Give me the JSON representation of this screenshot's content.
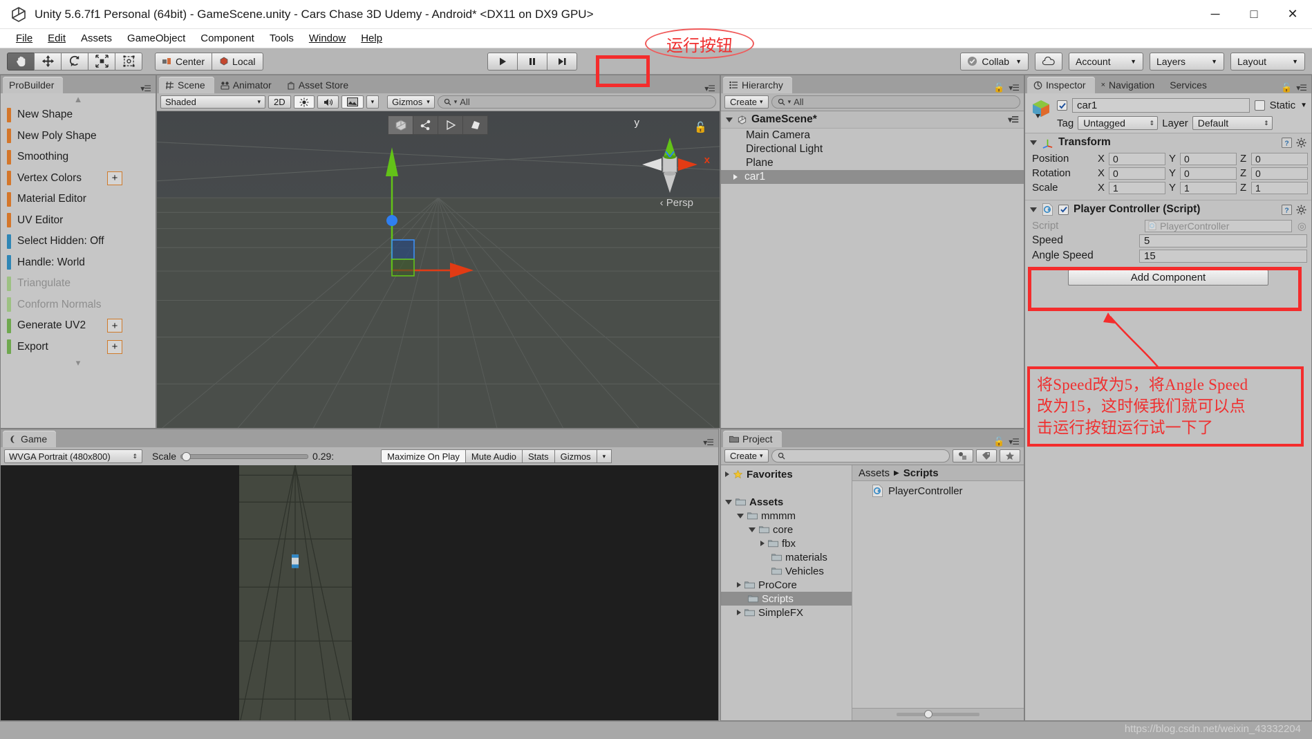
{
  "window": {
    "title": "Unity 5.6.7f1 Personal (64bit) - GameScene.unity - Cars Chase 3D Udemy - Android* <DX11 on DX9 GPU>",
    "minimize": "─",
    "maximize": "□",
    "close": "✕"
  },
  "menu": [
    "File",
    "Edit",
    "Assets",
    "GameObject",
    "Component",
    "Tools",
    "Window",
    "Help"
  ],
  "toolbar": {
    "transform_tools": [
      {
        "name": "hand-tool",
        "active": true
      },
      {
        "name": "move-tool",
        "active": false
      },
      {
        "name": "rotate-tool",
        "active": false
      },
      {
        "name": "scale-tool",
        "active": false
      },
      {
        "name": "rect-tool",
        "active": false
      }
    ],
    "pivot": "Center",
    "handle": "Local",
    "play": "▶",
    "pause": "❙❙",
    "step": "▶❙",
    "collab": "Collab",
    "cloud_icon": "cloud-icon",
    "account": "Account",
    "layers": "Layers",
    "layout": "Layout"
  },
  "probuilder": {
    "tab": "ProBuilder",
    "items": [
      {
        "label": "New Shape",
        "color": "#d4762a",
        "disabled": false,
        "plus": false
      },
      {
        "label": "New Poly Shape",
        "color": "#d4762a",
        "disabled": false,
        "plus": false
      },
      {
        "label": "Smoothing",
        "color": "#d4762a",
        "disabled": false,
        "plus": false
      },
      {
        "label": "Vertex Colors",
        "color": "#d4762a",
        "disabled": false,
        "plus": true
      },
      {
        "label": "Material Editor",
        "color": "#d4762a",
        "disabled": false,
        "plus": false
      },
      {
        "label": "UV Editor",
        "color": "#d4762a",
        "disabled": false,
        "plus": false
      },
      {
        "label": "Select Hidden: Off",
        "color": "#2f86b5",
        "disabled": false,
        "plus": false
      },
      {
        "label": "Handle: World",
        "color": "#2f86b5",
        "disabled": false,
        "plus": false
      },
      {
        "label": "Triangulate",
        "color": "#9dc183",
        "disabled": true,
        "plus": false
      },
      {
        "label": "Conform Normals",
        "color": "#9dc183",
        "disabled": true,
        "plus": false
      },
      {
        "label": "Generate UV2",
        "color": "#6fa84f",
        "disabled": false,
        "plus": true
      },
      {
        "label": "Export",
        "color": "#6fa84f",
        "disabled": false,
        "plus": true
      }
    ]
  },
  "scene": {
    "tabs": [
      {
        "label": "Scene",
        "icon": "grid-icon",
        "active": true
      },
      {
        "label": "Animator",
        "icon": "animator-icon",
        "active": false
      },
      {
        "label": "Asset Store",
        "icon": "store-icon",
        "active": false
      }
    ],
    "draw_mode": "Shaded",
    "two_d": "2D",
    "gizmos": "Gizmos",
    "search_placeholder": "All",
    "axis_x": "x",
    "axis_y": "y",
    "persp": "‹ Persp",
    "overlay_tools": [
      "shape-icon",
      "poly-icon",
      "face-icon",
      "material-icon"
    ]
  },
  "game": {
    "tab": "Game",
    "aspect": "WVGA Portrait (480x800)",
    "scale_label": "Scale",
    "scale_value": "0.29:",
    "maximize_on_play": "Maximize On Play",
    "mute_audio": "Mute Audio",
    "stats": "Stats",
    "gizmos": "Gizmos"
  },
  "hierarchy": {
    "tab": "Hierarchy",
    "create": "Create",
    "search_placeholder": "All",
    "scene_name": "GameScene*",
    "items": [
      {
        "label": "Main Camera",
        "selected": false,
        "expandable": false
      },
      {
        "label": "Directional Light",
        "selected": false,
        "expandable": false
      },
      {
        "label": "Plane",
        "selected": false,
        "expandable": false
      },
      {
        "label": "car1",
        "selected": true,
        "expandable": true
      }
    ]
  },
  "project": {
    "tab": "Project",
    "create": "Create",
    "search_placeholder": "",
    "tree": [
      {
        "label": "Favorites",
        "indent": 0,
        "arrow": "right",
        "icon": "star-icon",
        "bold": true,
        "selected": false
      },
      {
        "label": "",
        "indent": 0,
        "arrow": "none",
        "icon": "none",
        "bold": false,
        "selected": false
      },
      {
        "label": "Assets",
        "indent": 0,
        "arrow": "down",
        "icon": "folder-icon",
        "bold": true,
        "selected": false
      },
      {
        "label": "mmmm",
        "indent": 1,
        "arrow": "down",
        "icon": "folder-icon",
        "bold": false,
        "selected": false
      },
      {
        "label": "core",
        "indent": 2,
        "arrow": "down",
        "icon": "folder-icon",
        "bold": false,
        "selected": false
      },
      {
        "label": "fbx",
        "indent": 3,
        "arrow": "right",
        "icon": "folder-icon",
        "bold": false,
        "selected": false
      },
      {
        "label": "materials",
        "indent": 3,
        "arrow": "none",
        "icon": "folder-icon",
        "bold": false,
        "selected": false
      },
      {
        "label": "Vehicles",
        "indent": 3,
        "arrow": "none",
        "icon": "folder-icon",
        "bold": false,
        "selected": false
      },
      {
        "label": "ProCore",
        "indent": 1,
        "arrow": "right",
        "icon": "folder-icon",
        "bold": false,
        "selected": false
      },
      {
        "label": "Scripts",
        "indent": 1,
        "arrow": "none",
        "icon": "folder-icon",
        "bold": false,
        "selected": true
      },
      {
        "label": "SimpleFX",
        "indent": 1,
        "arrow": "right",
        "icon": "folder-icon",
        "bold": false,
        "selected": false
      }
    ],
    "breadcrumb": [
      "Assets",
      "Scripts"
    ],
    "files": [
      {
        "label": "PlayerController",
        "icon": "csharp-script-icon"
      }
    ]
  },
  "inspector": {
    "tabs": [
      {
        "label": "Inspector",
        "active": true
      },
      {
        "label": "Navigation",
        "active": false
      },
      {
        "label": "Services",
        "active": false
      }
    ],
    "object_name": "car1",
    "enabled": true,
    "static_label": "Static",
    "tag_label": "Tag",
    "tag_value": "Untagged",
    "layer_label": "Layer",
    "layer_value": "Default",
    "transform": {
      "title": "Transform",
      "rows": [
        {
          "label": "Position",
          "x": "0",
          "y": "0",
          "z": "0"
        },
        {
          "label": "Rotation",
          "x": "0",
          "y": "0",
          "z": "0"
        },
        {
          "label": "Scale",
          "x": "1",
          "y": "1",
          "z": "1"
        }
      ]
    },
    "player_controller": {
      "title": "Player Controller (Script)",
      "enabled": true,
      "script_label": "Script",
      "script_value": "PlayerController",
      "properties": [
        {
          "label": "Speed",
          "value": "5"
        },
        {
          "label": "Angle Speed",
          "value": "15"
        }
      ]
    },
    "add_component": "Add Component"
  },
  "annotations": {
    "play_callout": "运行按钮",
    "note_lines": [
      "将Speed改为5，将Angle Speed",
      "改为15，这时候我们就可以点",
      "击运行按钮运行试一下了"
    ],
    "color": "#f42c2c"
  },
  "watermark": "https://blog.csdn.net/weixin_43332204"
}
